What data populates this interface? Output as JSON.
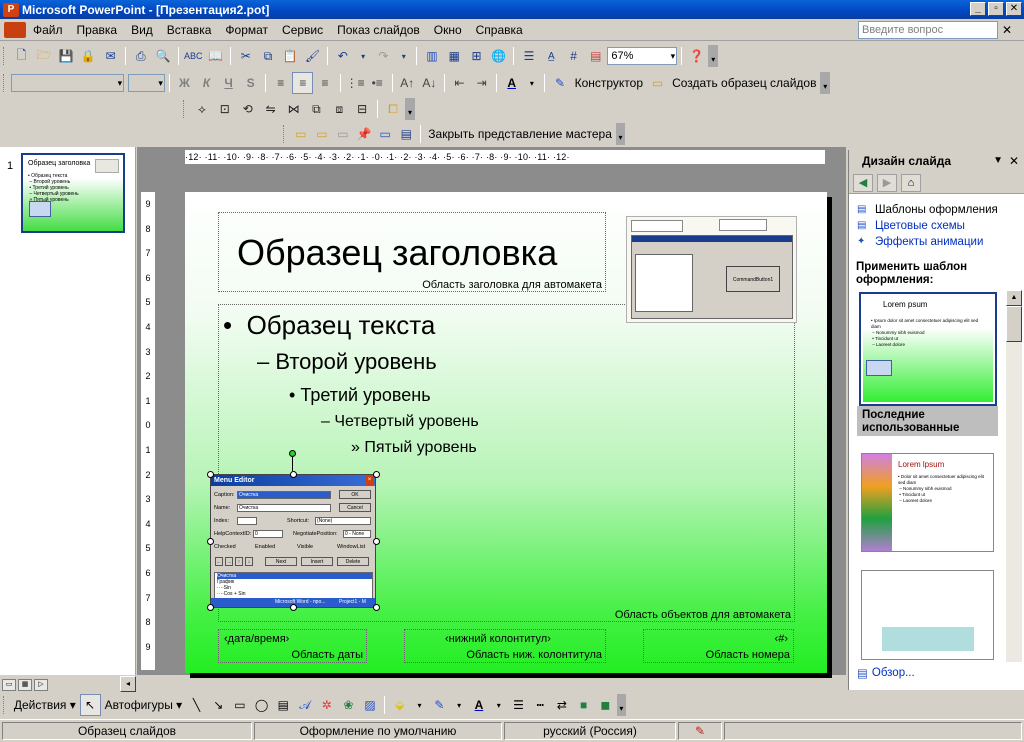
{
  "window": {
    "title": "Microsoft PowerPoint - [Презентация2.pot]",
    "controls": [
      "_",
      "▫",
      "✕"
    ]
  },
  "menu": {
    "items": [
      "Файл",
      "Правка",
      "Вид",
      "Вставка",
      "Формат",
      "Сервис",
      "Показ слайдов",
      "Окно",
      "Справка"
    ],
    "help_placeholder": "Введите вопрос",
    "close": "✕"
  },
  "toolbar_standard": {
    "zoom": "67%"
  },
  "toolbar_formatting": {
    "bold": "Ж",
    "italic": "К",
    "underline": "Ч",
    "shadow": "S",
    "designer_label": "Конструктор",
    "create_master_label": "Создать образец слайдов"
  },
  "toolbar_master": {
    "close_master_label": "Закрыть представление мастера"
  },
  "slides_pane": {
    "slide_number": "1",
    "thumb_title": "Образец заголовка",
    "thumb_text": "• Образец текста\n – Второй уровень\n • Третий уровень\n – Четвертый уровень\n » Пятый уровень"
  },
  "ruler": {
    "horizontal": "·12·  ·11·  ·10·  ·9·  ·8·  ·7·  ·6·  ·5·  ·4·  ·3·  ·2·  ·1·  ·0·  ·1·  ·2·  ·3·  ·4·  ·5·  ·6·  ·7·  ·8·  ·9·  ·10·  ·11·  ·12·",
    "vertical": [
      "9",
      "8",
      "7",
      "6",
      "5",
      "4",
      "3",
      "2",
      "1",
      "0",
      "1",
      "2",
      "3",
      "4",
      "5",
      "6",
      "7",
      "8",
      "9"
    ]
  },
  "slide": {
    "title": "Образец заголовка",
    "title_area_label": "Область заголовка для автомакета",
    "levels": [
      "Образец текста",
      "Второй уровень",
      "Третий уровень",
      "Четвертый уровень",
      "Пятый уровень"
    ],
    "bullets": [
      "•",
      "–",
      "•",
      "–",
      "»"
    ],
    "body_area_label": "Область объектов для автомакета",
    "footer_date": "‹дата/время›",
    "footer_date_label": "Область даты",
    "footer_text": "‹нижний колонтитул›",
    "footer_text_label": "Область ниж. колонтитула",
    "footer_num": "‹#›",
    "footer_num_label": "Область номера",
    "picture_top": {
      "button_text": "CommandButton1"
    },
    "menu_editor": {
      "title": "Menu Editor",
      "caption_label": "Caption:",
      "caption_value": "Очистка",
      "name_label": "Name:",
      "name_value": "Очистка",
      "index_label": "Index:",
      "shortcut_label": "Shortcut:",
      "shortcut_value": "(None)",
      "helpcontext_label": "HelpContextID:",
      "helpcontext_value": "0",
      "negotiate_label": "NegotiatePosition:",
      "negotiate_value": "0 - None",
      "checked": "Checked",
      "enabled": "Enabled",
      "visible": "Visible",
      "windowlist": "WindowList",
      "ok": "OK",
      "cancel": "Cancel",
      "next": "Next",
      "insert": "Insert",
      "delete": "Delete",
      "list": [
        "Очистка",
        "График",
        "····Sin",
        "····Cos + Sin"
      ],
      "task1": "Microsoft Word - про...",
      "task2": "Project1 - M"
    }
  },
  "task_pane": {
    "title": "Дизайн слайда",
    "links": [
      "Шаблоны оформления",
      "Цветовые схемы",
      "Эффекты анимации"
    ],
    "apply_label": "Применить шаблон оформления:",
    "template1_title": "Lorem  psum",
    "template1_text": "• Ipsum dolor sit amet consectetuer adipiscing elit sed diam\n – Nonummy nibh euismod\n • Tincidunt ut\n – Laoreet dolore",
    "recent_label": "Последние использованные",
    "template2_title": "Lorem lpsum",
    "template2_text": "• Dolor sit amet consectetuer adipiscing elit sed diam\n – Nonummy nibh euismod\n • Tincidunt ut\n – Laoreet dolore",
    "browse": "Обзор..."
  },
  "drawing_toolbar": {
    "actions": "Действия",
    "autoshapes": "Автофигуры"
  },
  "status": {
    "view": "Образец слайдов",
    "design": "Оформление по умолчанию",
    "language": "русский (Россия)"
  }
}
